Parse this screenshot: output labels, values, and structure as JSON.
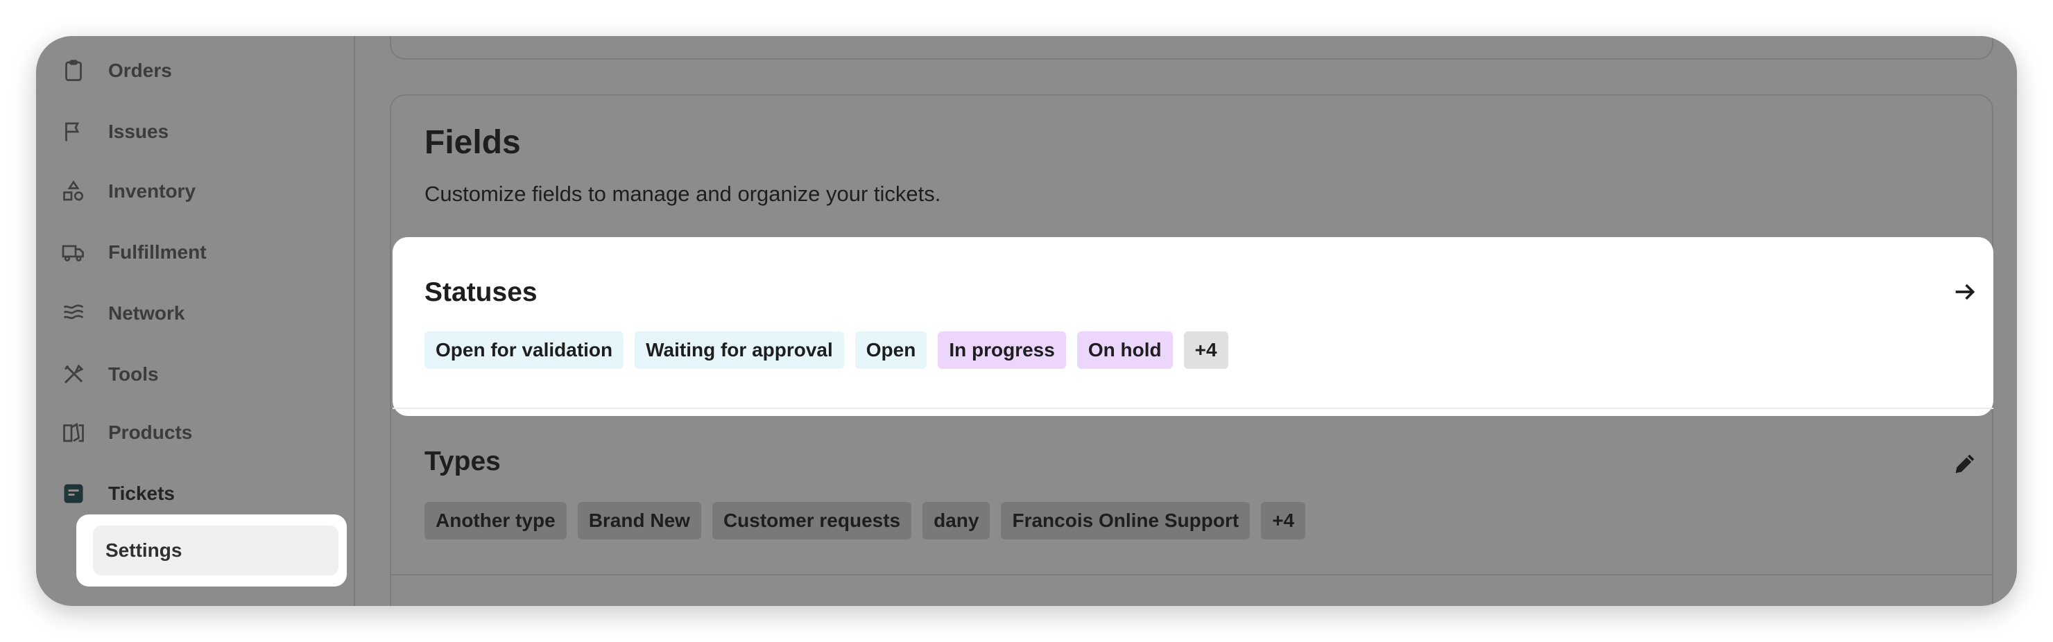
{
  "sidebar": {
    "items": [
      {
        "label": "Orders",
        "icon": "clipboard-icon"
      },
      {
        "label": "Issues",
        "icon": "flag-icon"
      },
      {
        "label": "Inventory",
        "icon": "shapes-icon"
      },
      {
        "label": "Fulfillment",
        "icon": "truck-icon"
      },
      {
        "label": "Network",
        "icon": "waves-icon"
      },
      {
        "label": "Tools",
        "icon": "tools-icon"
      },
      {
        "label": "Products",
        "icon": "book-icon"
      },
      {
        "label": "Tickets",
        "icon": "ticket-icon"
      }
    ],
    "sub_item": {
      "label": "Settings"
    }
  },
  "fields": {
    "title": "Fields",
    "subtitle": "Customize fields to manage and organize your tickets."
  },
  "statuses": {
    "title": "Statuses",
    "tags": [
      {
        "label": "Open for validation",
        "color": "#e6f6fb"
      },
      {
        "label": "Waiting for approval",
        "color": "#e6f6fb"
      },
      {
        "label": "Open",
        "color": "#e6f6fb"
      },
      {
        "label": "In progress",
        "color": "#ecd6fb"
      },
      {
        "label": "On hold",
        "color": "#ecd6fb"
      },
      {
        "label": "+4",
        "color": "#e0e0e0"
      }
    ]
  },
  "types": {
    "title": "Types",
    "tags": [
      {
        "label": "Another type"
      },
      {
        "label": "Brand New"
      },
      {
        "label": "Customer requests"
      },
      {
        "label": "dany"
      },
      {
        "label": "Francois Online Support"
      },
      {
        "label": "+4"
      }
    ]
  },
  "colors": {
    "overlay_bg": "#8c8c8c",
    "spotlight_bg": "#ffffff",
    "dim_tag_bg": "#797979"
  }
}
